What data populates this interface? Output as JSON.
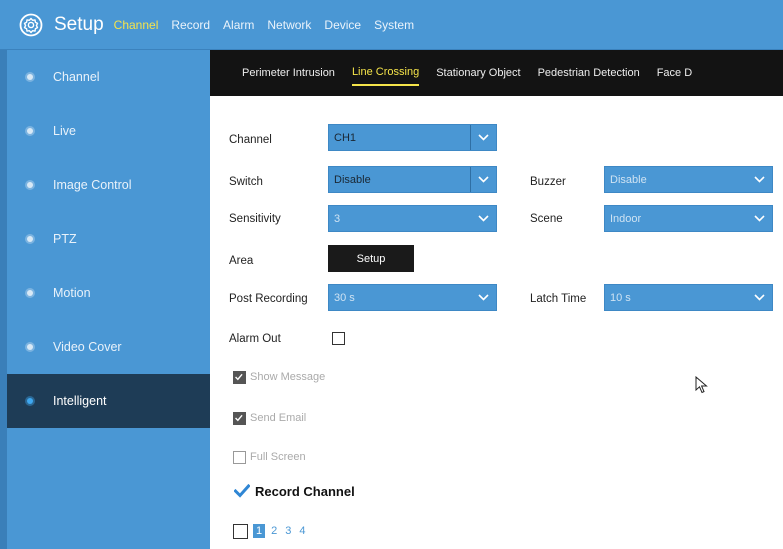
{
  "header": {
    "title": "Setup",
    "menu": [
      "Channel",
      "Record",
      "Alarm",
      "Network",
      "Device",
      "System"
    ],
    "active_menu": "Channel"
  },
  "sidebar": {
    "items": [
      {
        "label": "Channel"
      },
      {
        "label": "Live"
      },
      {
        "label": "Image Control"
      },
      {
        "label": "PTZ"
      },
      {
        "label": "Motion"
      },
      {
        "label": "Video Cover"
      },
      {
        "label": "Intelligent"
      }
    ],
    "active": "Intelligent"
  },
  "tabs": {
    "items": [
      "Perimeter Intrusion",
      "Line Crossing",
      "Stationary Object",
      "Pedestrian Detection",
      "Face D"
    ],
    "active": "Line Crossing"
  },
  "form": {
    "channel": {
      "label": "Channel",
      "value": "CH1"
    },
    "switch": {
      "label": "Switch",
      "value": "Disable"
    },
    "buzzer": {
      "label": "Buzzer",
      "value": "Disable"
    },
    "sensitivity": {
      "label": "Sensitivity",
      "value": "3"
    },
    "scene": {
      "label": "Scene",
      "value": "Indoor"
    },
    "area": {
      "label": "Area",
      "button": "Setup"
    },
    "post_recording": {
      "label": "Post Recording",
      "value": "30 s"
    },
    "latch_time": {
      "label": "Latch Time",
      "value": "10 s"
    },
    "alarm_out": {
      "label": "Alarm Out",
      "checked": false
    },
    "show_message": {
      "label": "Show Message",
      "checked": true,
      "disabled": true
    },
    "send_email": {
      "label": "Send Email",
      "checked": true,
      "disabled": true
    },
    "full_screen": {
      "label": "Full Screen",
      "checked": false,
      "disabled": true
    },
    "record_channel": {
      "label": "Record Channel",
      "checked": true
    },
    "record_channels": {
      "all_checked": false,
      "numbers": [
        "1",
        "2",
        "3",
        "4"
      ],
      "selected": "1"
    }
  },
  "colors": {
    "accent": "#4a97d4",
    "active_text": "#f5e44a",
    "tab_bar": "#131313",
    "sidebar_active": "#1e3c56"
  }
}
